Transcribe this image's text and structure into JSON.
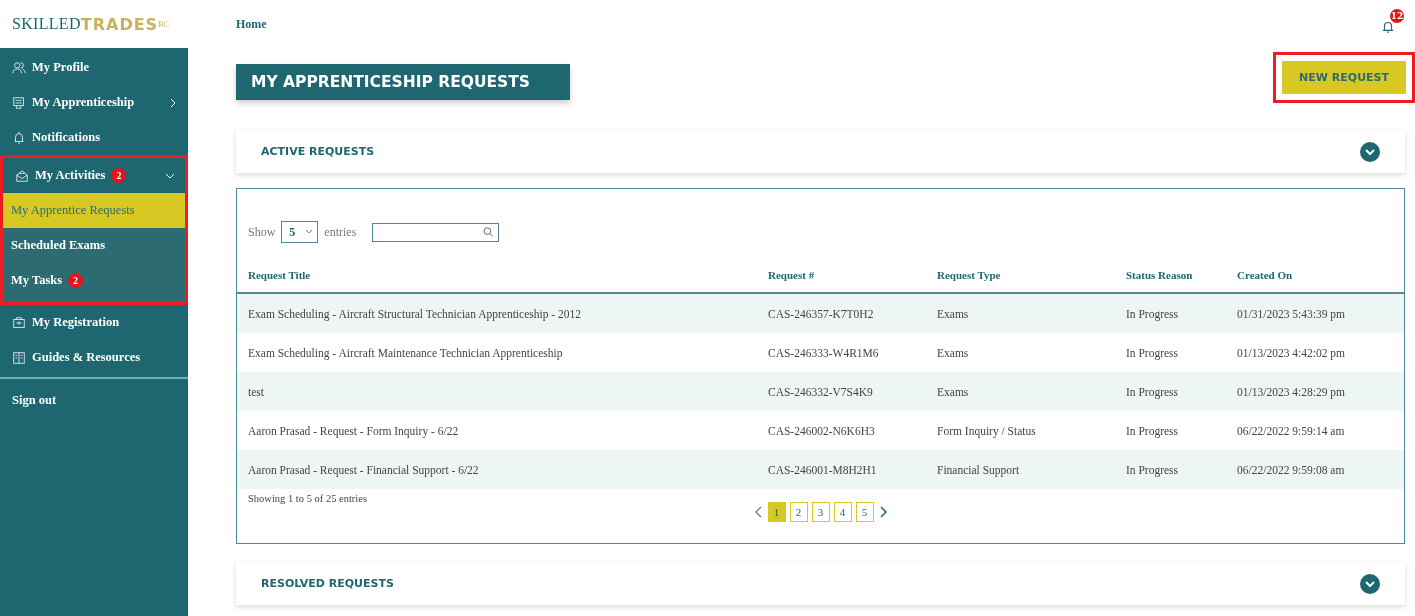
{
  "logo": {
    "word1": "SKILLED",
    "word2": "TRADES",
    "sup": "BC"
  },
  "breadcrumb": "Home",
  "notifications": {
    "count": "12"
  },
  "sidebar": {
    "items": [
      {
        "label": "My Profile"
      },
      {
        "label": "My Apprenticeship",
        "expanded": false,
        "has_submenu": true
      },
      {
        "label": "Notifications"
      },
      {
        "label": "My Activities",
        "badge": "2",
        "expanded": true,
        "has_submenu": true,
        "highlighted": true,
        "children": [
          {
            "label": "My Apprentice Requests",
            "selected": true
          },
          {
            "label": "Scheduled Exams",
            "selected": false
          },
          {
            "label": "My Tasks",
            "badge": "2",
            "selected": false
          }
        ]
      },
      {
        "label": "My Registration"
      },
      {
        "label": "Guides & Resources"
      }
    ],
    "sign_out": "Sign out"
  },
  "page_title": "MY APPRENTICESHIP REQUESTS",
  "new_request_button": {
    "label": "NEW REQUEST",
    "highlighted": true
  },
  "active_section": {
    "title": "ACTIVE REQUESTS",
    "expanded": true
  },
  "table": {
    "show_label": "Show",
    "page_size": "5",
    "entries_label": "entries",
    "columns": [
      "Request Title",
      "Request #",
      "Request Type",
      "Status Reason",
      "Created On"
    ],
    "rows": [
      [
        "Exam Scheduling - Aircraft Structural Technician Apprenticeship - 2012",
        "CAS-246357-K7T0H2",
        "Exams",
        "In Progress",
        "01/31/2023 5:43:39 pm"
      ],
      [
        "Exam Scheduling - Aircraft Maintenance Technician Apprenticeship",
        "CAS-246333-W4R1M6",
        "Exams",
        "In Progress",
        "01/13/2023 4:42:02 pm"
      ],
      [
        "test",
        "CAS-246332-V7S4K9",
        "Exams",
        "In Progress",
        "01/13/2023 4:28:29 pm"
      ],
      [
        "Aaron Prasad - Request - Form Inquiry - 6/22",
        "CAS-246002-N6K6H3",
        "Form Inquiry / Status",
        "In Progress",
        "06/22/2022 9:59:14 am"
      ],
      [
        "Aaron Prasad - Request - Financial Support - 6/22",
        "CAS-246001-M8H2H1",
        "Financial Support",
        "In Progress",
        "06/22/2022 9:59:08 am"
      ]
    ],
    "info": "Showing 1 to 5 of 25 entries",
    "pages": [
      {
        "label": "1",
        "selected": true
      },
      {
        "label": "2",
        "selected": false
      },
      {
        "label": "3",
        "selected": false
      },
      {
        "label": "4",
        "selected": false
      },
      {
        "label": "5",
        "selected": false
      }
    ]
  },
  "resolved_section": {
    "title": "RESOLVED REQUESTS",
    "expanded": false
  }
}
